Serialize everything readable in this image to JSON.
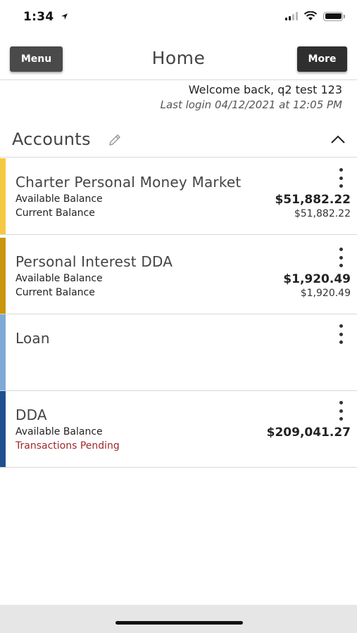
{
  "status_bar": {
    "time": "1:34",
    "location_icon": "location-arrow-icon",
    "signal_icon": "cellular-signal-icon",
    "wifi_icon": "wifi-icon",
    "battery_icon": "battery-icon"
  },
  "header": {
    "menu_label": "Menu",
    "title": "Home",
    "more_label": "More"
  },
  "welcome": {
    "message": "Welcome back, q2 test 123",
    "last_login": "Last login 04/12/2021 at 12:05 PM"
  },
  "accounts": {
    "title": "Accounts",
    "edit_icon": "pencil-icon",
    "collapse_icon": "chevron-up-icon",
    "items": [
      {
        "name": "Charter Personal Money Market",
        "label1": "Available Balance",
        "amount1": "$51,882.22",
        "label2": "Current Balance",
        "amount2": "$51,882.22",
        "color": "#f5c842"
      },
      {
        "name": "Personal Interest DDA",
        "label1": "Available Balance",
        "amount1": "$1,920.49",
        "label2": "Current Balance",
        "amount2": "$1,920.49",
        "color": "#c9960e"
      },
      {
        "name": "Loan",
        "color": "#7fa9d6"
      },
      {
        "name": "DDA",
        "label1": "Available Balance",
        "amount1": "$209,041.27",
        "label2": "Transactions Pending",
        "color": "#1f4f8f"
      }
    ]
  },
  "colors": {
    "header_button_bg": "#2f2f2f",
    "pending_text": "#a0282b",
    "divider": "#d8d8d8"
  }
}
